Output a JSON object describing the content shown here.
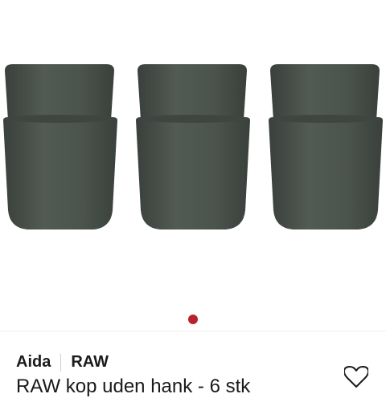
{
  "product": {
    "brand": "Aida",
    "series": "RAW",
    "title": "RAW kop uden hank - 6 stk"
  },
  "gallery": {
    "image_count": 1,
    "current_index": 1
  },
  "colors": {
    "cup_body": "#4f5750",
    "cup_rim": "#3f4641",
    "cup_shadow": "#3a403b",
    "dot_active": "#b8222a",
    "text": "#1a1a1a"
  },
  "icons": {
    "favorite": "heart-outline-icon"
  }
}
